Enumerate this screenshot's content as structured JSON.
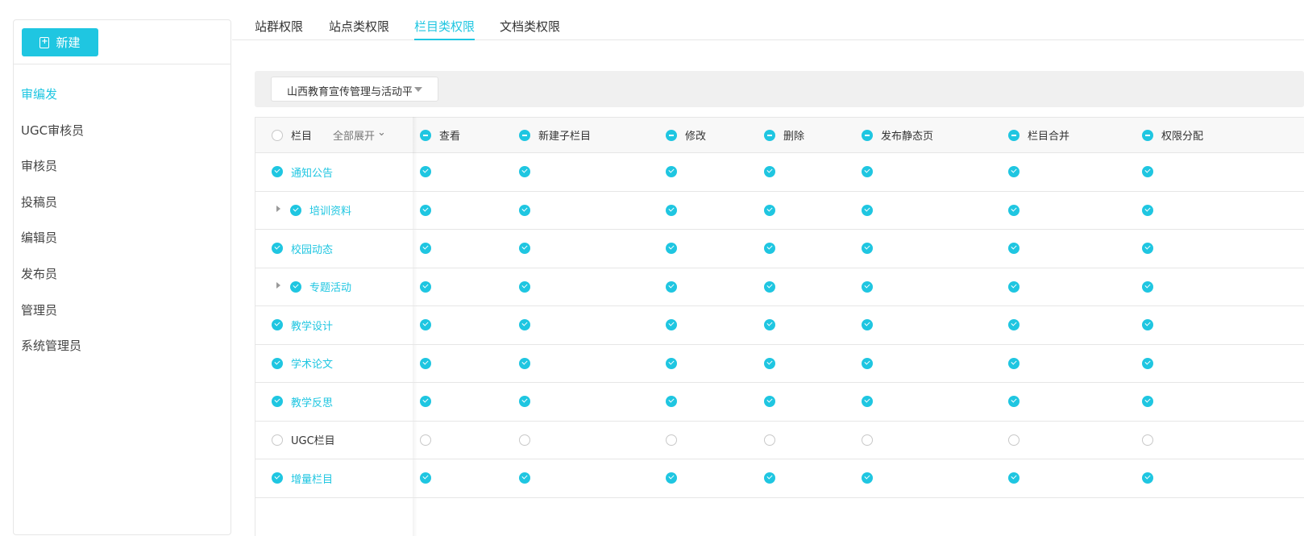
{
  "sidebar": {
    "new_button": "新建",
    "items": [
      "审编发",
      "UGC审核员",
      "审核员",
      "投稿员",
      "编辑员",
      "发布员",
      "管理员",
      "系统管理员"
    ],
    "active": 0
  },
  "tabs": [
    "站群权限",
    "站点类权限",
    "栏目类权限",
    "文档类权限"
  ],
  "active_tab": 2,
  "filter": {
    "site_select": "山西教育宣传管理与活动平"
  },
  "table": {
    "column_header": "栏目",
    "expand_all": "全部展开",
    "permissions": [
      "查看",
      "新建子栏目",
      "修改",
      "删除",
      "发布静态页",
      "栏目合并",
      "权限分配"
    ],
    "rows": [
      {
        "name": "通知公告",
        "checked": true,
        "child": false
      },
      {
        "name": "培训资料",
        "checked": true,
        "child": true
      },
      {
        "name": "校园动态",
        "checked": true,
        "child": false
      },
      {
        "name": "专题活动",
        "checked": true,
        "child": true
      },
      {
        "name": "教学设计",
        "checked": true,
        "child": false
      },
      {
        "name": "学术论文",
        "checked": true,
        "child": false
      },
      {
        "name": "教学反思",
        "checked": true,
        "child": false
      },
      {
        "name": "UGC栏目",
        "checked": false,
        "child": false
      },
      {
        "name": "增量栏目",
        "checked": true,
        "child": false
      }
    ]
  },
  "colors": {
    "accent": "#1fc6e1"
  }
}
